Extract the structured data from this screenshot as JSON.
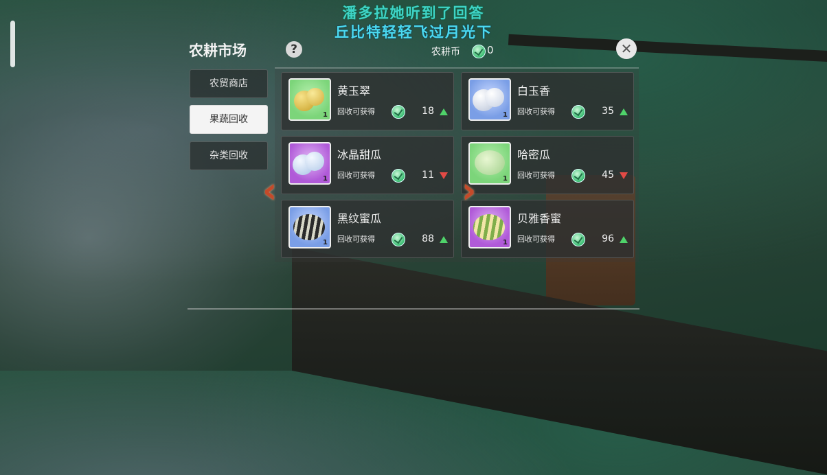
{
  "lyrics": {
    "line1": "潘多拉她听到了回答",
    "line2": "丘比特轻轻飞过月光下"
  },
  "market": {
    "title": "农耕市场",
    "help_symbol": "?",
    "coin_label": "农耕币",
    "coin_value": "0",
    "close_symbol": "✕"
  },
  "tabs": [
    {
      "label": "农贸商店",
      "active": false
    },
    {
      "label": "果蔬回收",
      "active": true
    },
    {
      "label": "杂类回收",
      "active": false
    }
  ],
  "items": [
    {
      "name": "黄玉翠",
      "reward_label": "回收可获得",
      "price": "18",
      "trend": "up",
      "qty": "1",
      "bg": "green"
    },
    {
      "name": "白玉香",
      "reward_label": "回收可获得",
      "price": "35",
      "trend": "up",
      "qty": "1",
      "bg": "blue"
    },
    {
      "name": "冰晶甜瓜",
      "reward_label": "回收可获得",
      "price": "11",
      "trend": "down",
      "qty": "1",
      "bg": "purple"
    },
    {
      "name": "哈密瓜",
      "reward_label": "回收可获得",
      "price": "45",
      "trend": "down",
      "qty": "1",
      "bg": "green"
    },
    {
      "name": "黑纹蜜瓜",
      "reward_label": "回收可获得",
      "price": "88",
      "trend": "up",
      "qty": "1",
      "bg": "blue"
    },
    {
      "name": "贝雅香蜜",
      "reward_label": "回收可获得",
      "price": "96",
      "trend": "up",
      "qty": "1",
      "bg": "purple"
    }
  ],
  "nav": {
    "prev_symbol": "‹",
    "next_symbol": "›"
  },
  "colors": {
    "trend_up": "#4fd36a",
    "trend_down": "#e24a45",
    "lyric1": "#3fd3c6",
    "lyric2": "#4bd9f0"
  },
  "icons": {
    "coin": "leaf-coin-icon",
    "close": "close-icon",
    "help": "help-icon"
  }
}
